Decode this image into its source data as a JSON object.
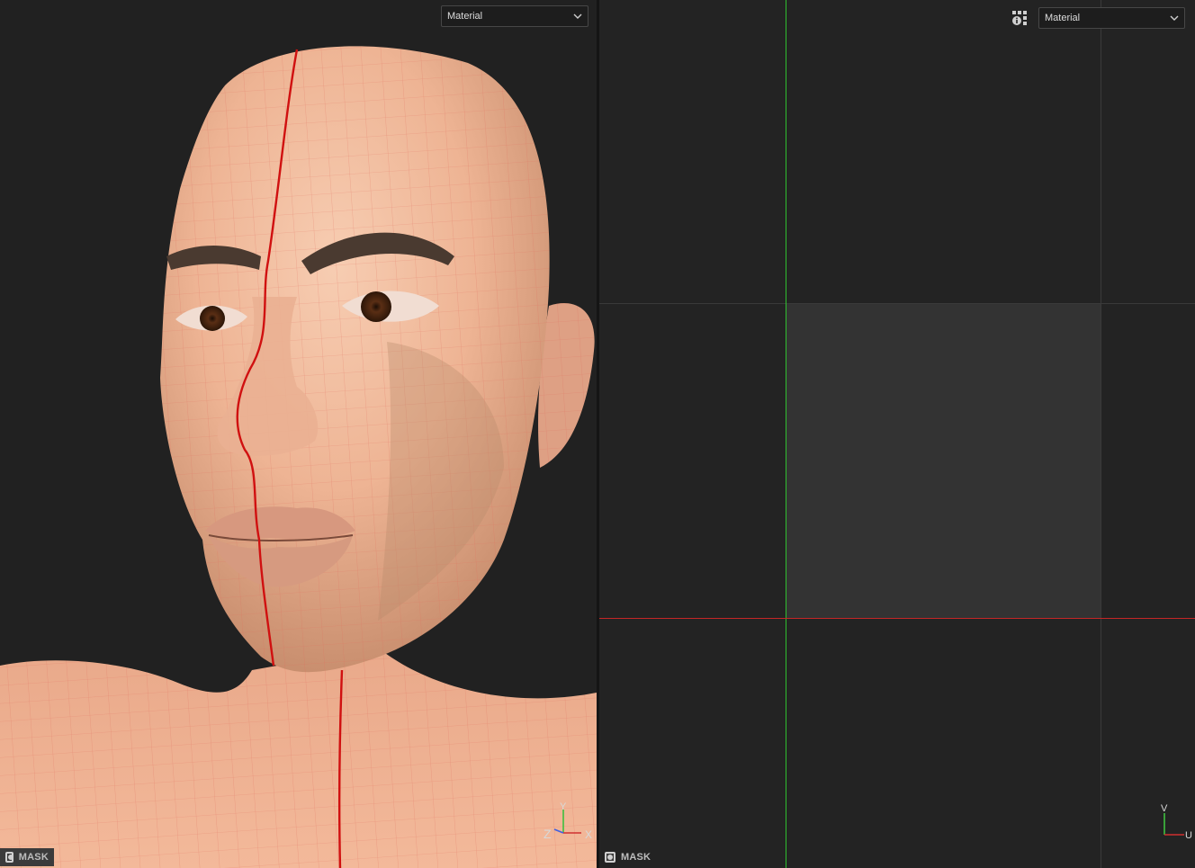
{
  "viewport_3d": {
    "shading_mode": "Material",
    "mask_label": "MASK",
    "gizmo": {
      "axes": [
        "Z",
        "Y",
        "X"
      ]
    }
  },
  "viewport_uv": {
    "shading_mode": "Material",
    "mask_label": "MASK",
    "gizmo": {
      "axes": [
        "V",
        "U"
      ]
    },
    "info_icon": "info-grid-icon"
  },
  "colors": {
    "background": "#222222",
    "uv_tile": "#333333",
    "v_axis": "#2fbf2f",
    "u_axis": "#c42626",
    "seam": "#d01010",
    "wireframe": "#e06a5a",
    "skin": "#f2b99c"
  }
}
